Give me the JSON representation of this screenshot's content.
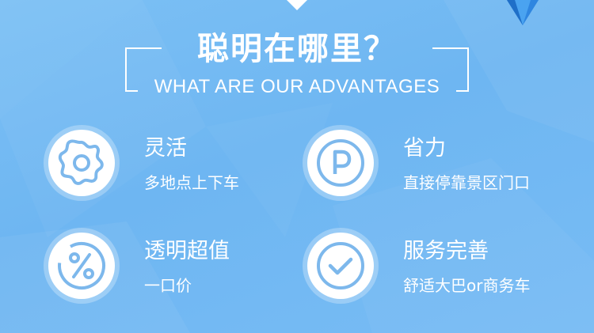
{
  "header": {
    "title": "聪明在哪里？",
    "subtitle": "WHAT ARE OUR ADVANTAGES"
  },
  "features": [
    {
      "title": "灵活",
      "desc": "多地点上下车",
      "icon": "gear-icon"
    },
    {
      "title": "省力",
      "desc": "直接停靠景区门口",
      "icon": "parking-icon"
    },
    {
      "title": "透明超值",
      "desc": "一口价",
      "icon": "percent-icon"
    },
    {
      "title": "服务完善",
      "desc": "舒适大巴or商务车",
      "icon": "checkmark-icon"
    }
  ],
  "colors": {
    "background": "#74baf3",
    "icon_stroke": "#7db8ec",
    "text": "#ffffff"
  }
}
